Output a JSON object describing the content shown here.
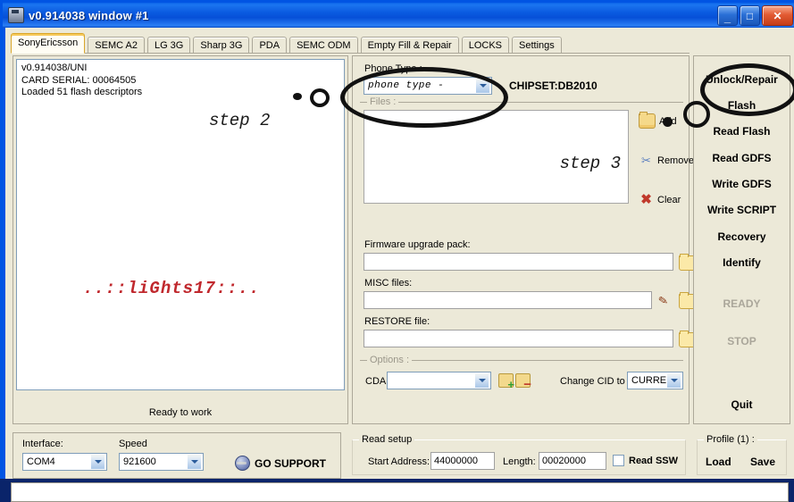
{
  "window": {
    "title": "v0.914038 window #1",
    "icon": "card-icon",
    "buttons": {
      "minimize": "_",
      "maximize": "□",
      "close": "✕"
    }
  },
  "tabs": [
    {
      "label": "SonyEricsson",
      "active": true
    },
    {
      "label": "SEMC A2",
      "active": false
    },
    {
      "label": "LG 3G",
      "active": false
    },
    {
      "label": "Sharp 3G",
      "active": false
    },
    {
      "label": "PDA",
      "active": false
    },
    {
      "label": "SEMC ODM",
      "active": false
    },
    {
      "label": "Empty Fill & Repair",
      "active": false
    },
    {
      "label": "LOCKS",
      "active": false
    },
    {
      "label": "Settings",
      "active": false
    }
  ],
  "log": {
    "lines": [
      "v0.914038/UNI",
      "CARD SERIAL: 00064505",
      "Loaded 51 flash descriptors"
    ],
    "watermark": "..::liGhts17::..",
    "watermark_color": "#c0282d",
    "status": "Ready to work"
  },
  "annotations": {
    "step2": "step 2",
    "step3": "step 3"
  },
  "phone": {
    "type_label": "Phone Type :",
    "type_value": "phone type -",
    "chipset": "CHIPSET:DB2010",
    "files_label": "Files :"
  },
  "file_actions": [
    {
      "label": "Add",
      "icon": "folder-add-icon"
    },
    {
      "label": "Remove",
      "icon": "scissors-icon"
    },
    {
      "label": "Clear",
      "icon": "red-x-icon"
    }
  ],
  "fields": [
    {
      "label": "Firmware upgrade pack:",
      "value": "",
      "browse_icon": "folder-open-icon",
      "edit_icon": null
    },
    {
      "label": "MISC files:",
      "value": "",
      "browse_icon": "folder-open-icon",
      "edit_icon": "pencil-icon"
    },
    {
      "label": "RESTORE file:",
      "value": "",
      "browse_icon": "folder-open-icon",
      "edit_icon": null
    }
  ],
  "options": {
    "group_label": "Options :",
    "cda_label": "CDA",
    "cda_value": "",
    "add_icon": "add-card-icon",
    "remove_icon": "remove-card-icon",
    "change_cid_label": "Change CID to",
    "change_cid_value": "CURRENT"
  },
  "actions": [
    {
      "label": "Unlock/Repair",
      "enabled": true
    },
    {
      "label": "Flash",
      "enabled": true,
      "highlighted": true
    },
    {
      "label": "Read Flash",
      "enabled": true
    },
    {
      "label": "Read GDFS",
      "enabled": true
    },
    {
      "label": "Write GDFS",
      "enabled": true
    },
    {
      "label": "Write SCRIPT",
      "enabled": true
    },
    {
      "label": "Recovery",
      "enabled": true
    },
    {
      "label": "Identify",
      "enabled": true
    },
    {
      "label": "READY",
      "enabled": false
    },
    {
      "label": "STOP",
      "enabled": false
    },
    {
      "label": "Quit",
      "enabled": true
    }
  ],
  "connection": {
    "interface_label": "Interface:",
    "interface_value": "COM4",
    "speed_label": "Speed",
    "speed_value": "921600",
    "support_label": "GO SUPPORT",
    "support_icon": "globe-icon"
  },
  "read_setup": {
    "group_label": "Read setup",
    "start_label": "Start Address:",
    "start_value": "44000000",
    "length_label": "Length:",
    "length_value": "00020000",
    "ssw_label": "Read SSW",
    "ssw_checked": false
  },
  "profile": {
    "group_label": "Profile (1) :",
    "load_label": "Load",
    "save_label": "Save"
  }
}
